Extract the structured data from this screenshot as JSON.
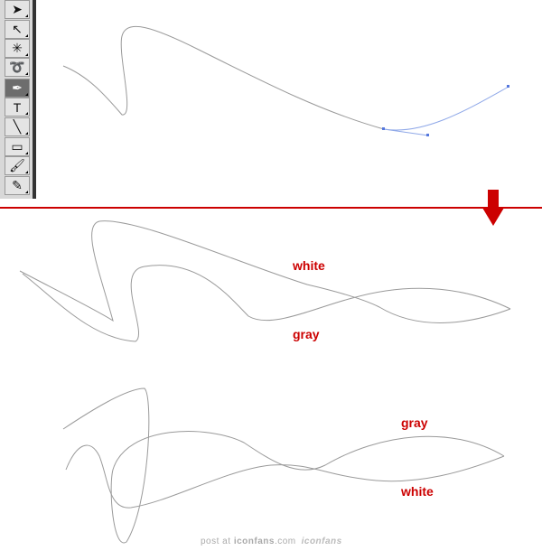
{
  "toolbar": {
    "tools": [
      {
        "name": "selection-tool",
        "glyph": "➤"
      },
      {
        "name": "direct-selection-tool",
        "glyph": "↖"
      },
      {
        "name": "magic-wand-tool",
        "glyph": "✳"
      },
      {
        "name": "lasso-tool",
        "glyph": "➰"
      },
      {
        "name": "pen-tool",
        "glyph": "✒",
        "selected": true
      },
      {
        "name": "type-tool",
        "glyph": "T"
      },
      {
        "name": "line-tool",
        "glyph": "╲"
      },
      {
        "name": "rectangle-tool",
        "glyph": "▭"
      },
      {
        "name": "paintbrush-tool",
        "glyph": "🖌"
      },
      {
        "name": "pencil-tool",
        "glyph": "✎"
      }
    ]
  },
  "labels": {
    "mid_white": "white",
    "mid_gray": "gray",
    "bottom_gray": "gray",
    "bottom_white": "white"
  },
  "credit": {
    "prefix": "post at ",
    "site": "iconfans",
    "suffix": ".com",
    "logo": "iconfans"
  },
  "colors": {
    "accent": "#cc0000",
    "stroke": "#999999",
    "path_selected": "#8fa8e8"
  }
}
